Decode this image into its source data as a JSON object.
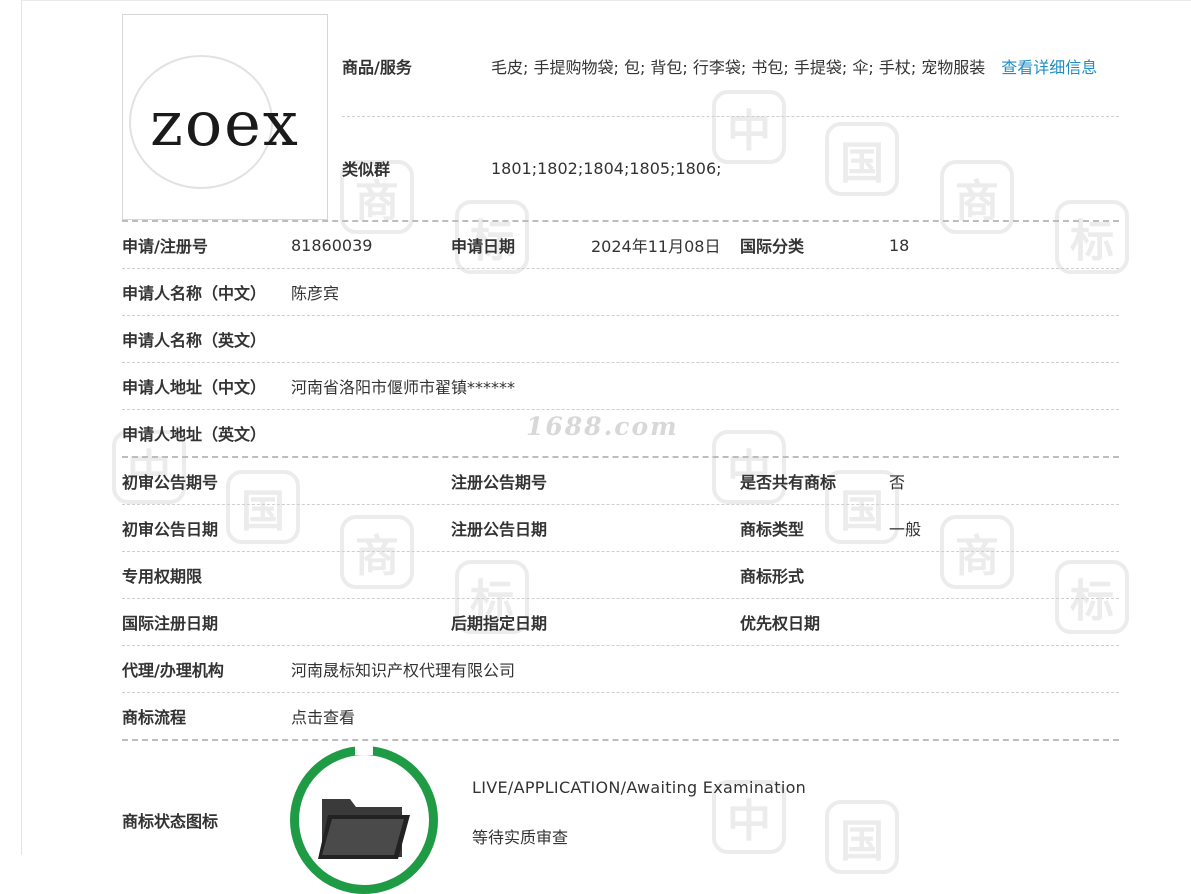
{
  "watermark": {
    "chars": [
      "中",
      "国",
      "商",
      "标"
    ],
    "site": "1688.com"
  },
  "logo": {
    "text": "zoex"
  },
  "goods": {
    "label": "商品/服务",
    "value": "毛皮; 手提购物袋; 包; 背包; 行李袋; 书包; 手提袋; 伞; 手杖; 宠物服装",
    "link": "查看详细信息"
  },
  "similar": {
    "label": "类似群",
    "value": "1801;1802;1804;1805;1806;"
  },
  "rows": {
    "reg_no": {
      "label": "申请/注册号",
      "value": "81860039"
    },
    "apply_date": {
      "label": "申请日期",
      "value": "2024年11月08日"
    },
    "intl_class": {
      "label": "国际分类",
      "value": "18"
    },
    "applicant_cn": {
      "label": "申请人名称（中文）",
      "value": "陈彦宾"
    },
    "applicant_en": {
      "label": "申请人名称（英文）",
      "value": ""
    },
    "address_cn": {
      "label": "申请人地址（中文）",
      "value": "河南省洛阳市偃师市翟镇******"
    },
    "address_en": {
      "label": "申请人地址（英文）",
      "value": ""
    },
    "prelim_no": {
      "label": "初审公告期号",
      "value": ""
    },
    "reg_pub_no": {
      "label": "注册公告期号",
      "value": ""
    },
    "shared": {
      "label": "是否共有商标",
      "value": "否"
    },
    "prelim_date": {
      "label": "初审公告日期",
      "value": ""
    },
    "reg_pub_date": {
      "label": "注册公告日期",
      "value": ""
    },
    "tm_type": {
      "label": "商标类型",
      "value": "一般"
    },
    "exclusive_term": {
      "label": "专用权期限",
      "value": ""
    },
    "tm_form": {
      "label": "商标形式",
      "value": ""
    },
    "intl_reg_date": {
      "label": "国际注册日期",
      "value": ""
    },
    "later_designation": {
      "label": "后期指定日期",
      "value": ""
    },
    "priority_date": {
      "label": "优先权日期",
      "value": ""
    },
    "agent": {
      "label": "代理/办理机构",
      "value": "河南晟标知识产权代理有限公司"
    },
    "process": {
      "label": "商标流程",
      "link": "点击查看"
    }
  },
  "status": {
    "label": "商标状态图标",
    "icon": "folder-icon",
    "ring_color": "#1f9a45",
    "text_en": "LIVE/APPLICATION/Awaiting Examination",
    "text_cn": "等待实质审查"
  },
  "colors": {
    "link": "#1f8ec5",
    "divider": "#cfcfcf"
  }
}
